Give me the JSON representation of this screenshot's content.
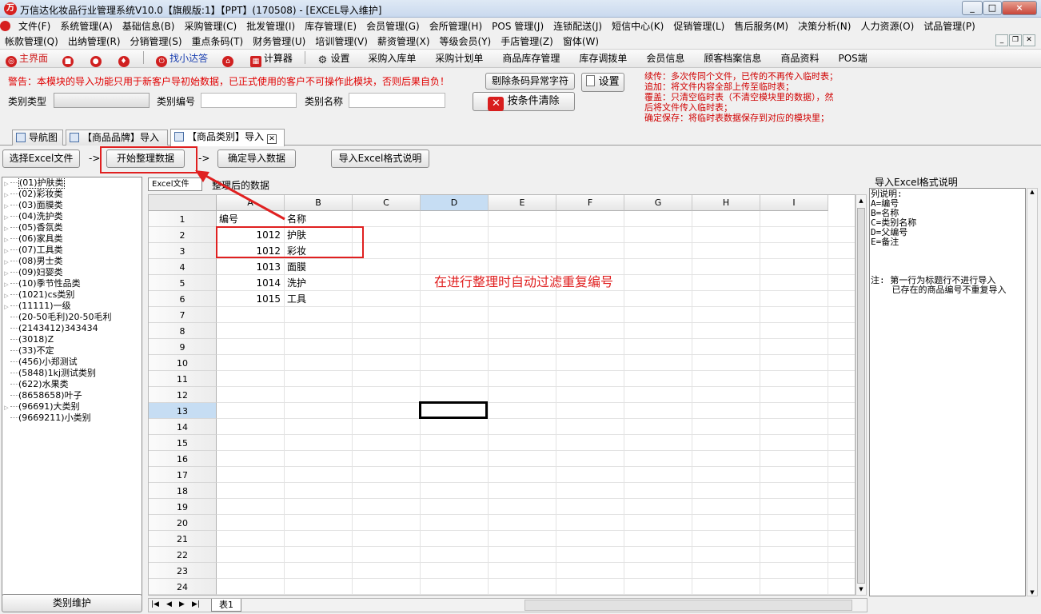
{
  "window": {
    "title": "万信达化妆品行业管理系统V10.0【旗舰版:1】【PPT】(170508) - [EXCEL导入维护]",
    "controls": [
      "_",
      "□",
      "×"
    ]
  },
  "menu1": [
    "文件(F)",
    "系统管理(A)",
    "基础信息(B)",
    "采购管理(C)",
    "批发管理(I)",
    "库存管理(E)",
    "会员管理(G)",
    "会所管理(H)",
    "POS 管理(J)",
    "连锁配送(J)",
    "短信中心(K)",
    "促销管理(L)",
    "售后服务(M)",
    "决策分析(N)",
    "人力资源(O)",
    "试品管理(P)"
  ],
  "menu2": [
    "帐款管理(Q)",
    "出纳管理(R)",
    "分销管理(S)",
    "重点条码(T)",
    "财务管理(U)",
    "培训管理(V)",
    "薪资管理(X)",
    "等级会员(Y)",
    "手店管理(Z)",
    "窗体(W)"
  ],
  "toolbar": {
    "main": "主界面",
    "find": "找小达答",
    "calc": "计算器",
    "settings": "设置",
    "quick": [
      "采购入库单",
      "采购计划单",
      "商品库存管理",
      "库存调拨单",
      "会员信息",
      "顾客档案信息",
      "商品资料",
      "POS端"
    ]
  },
  "form": {
    "warning": "警告：本模块的导入功能只用于新客户导初始数据，已正式使用的客户不可操作此模块，否则后果自负！",
    "type_label": "类别类型",
    "code_label": "类别编号",
    "name_label": "类别名称",
    "btn_remove_barcode": "剔除条码异常字符",
    "btn_clear": "按条件清除",
    "btn_settings": "设置",
    "hints": [
      "续传：多次传同个文件，已传的不再传入临时表；",
      "追加：将文件内容全部上传至临时表；",
      "覆盖：只清空临时表（不清空模块里的数据），然",
      "后将文件传入临时表；",
      "确定保存：将临时表数据保存到对应的模块里；"
    ]
  },
  "tabs": [
    "导航图",
    "【商品品牌】导入",
    "【商品类别】导入"
  ],
  "actions": {
    "select_excel": "选择Excel文件",
    "start": "开始整理数据",
    "confirm": "确定导入数据",
    "format_help": "导入Excel格式说明",
    "arrow": "->"
  },
  "tree": [
    "(01)护肤类",
    "(02)彩妆类",
    "(03)面膜类",
    "(04)洗护类",
    "(05)香氛类",
    "(06)家具类",
    "(07)工具类",
    "(08)男士类",
    "(09)妇婴类",
    "(10)季节性品类",
    "(1021)cs类别",
    "(11111)一级",
    "(20-50毛利)20-50毛利",
    "(2143412)343434",
    "(3018)Z",
    "(33)不定",
    "(456)小郑测试",
    "(5848)1kj测试类别",
    "(622)水果类",
    "(8658658)叶子",
    "(96691)大类别",
    "(9669211)小类别"
  ],
  "cat_maint": "类别维护",
  "sheet": {
    "tab_label": "Excel文件",
    "title": "整理后的数据",
    "columns": [
      "A",
      "B",
      "C",
      "D",
      "E",
      "F",
      "G",
      "H",
      "I"
    ],
    "rows": [
      "1",
      "2",
      "3",
      "4",
      "5",
      "6",
      "7",
      "8",
      "9",
      "10",
      "11",
      "12",
      "13",
      "14",
      "15",
      "16",
      "17",
      "18",
      "19",
      "20",
      "21",
      "22",
      "23",
      "24"
    ],
    "data": [
      [
        "编号",
        "名称"
      ],
      [
        "1012",
        "护肤"
      ],
      [
        "1012",
        "彩妆"
      ],
      [
        "1013",
        "面膜"
      ],
      [
        "1014",
        "洗护"
      ],
      [
        "1015",
        "工具"
      ]
    ],
    "sheet_tab": "表1"
  },
  "annotation": "在进行整理时自动过滤重复编号",
  "format_panel": {
    "title": "导入Excel格式说明",
    "lines": [
      "列说明:",
      "A=编号",
      "B=名称",
      "C=类别名称",
      "D=父编号",
      "E=备注",
      "",
      "",
      "",
      "注: 第一行为标题行不进行导入",
      "    已存在的商品编号不重复导入"
    ]
  }
}
